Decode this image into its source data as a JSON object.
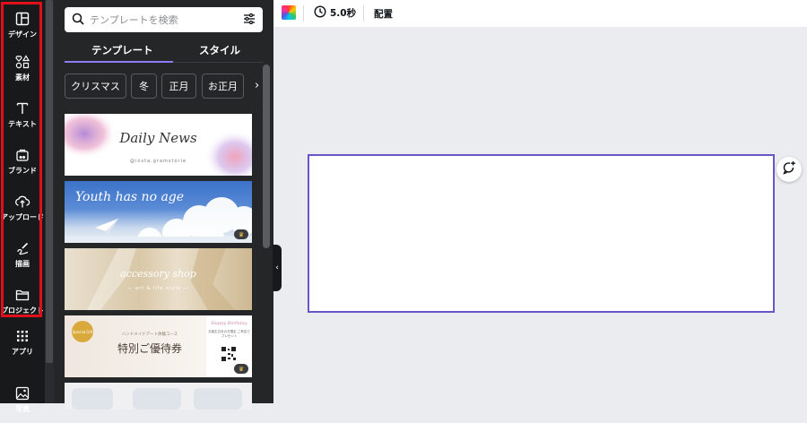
{
  "rail": {
    "items": [
      {
        "label": "デザイン",
        "icon": "layout-icon"
      },
      {
        "label": "素材",
        "icon": "shapes-icon"
      },
      {
        "label": "テキスト",
        "icon": "text-icon"
      },
      {
        "label": "ブランド",
        "icon": "brand-icon"
      },
      {
        "label": "アップロード",
        "icon": "upload-icon"
      },
      {
        "label": "描画",
        "icon": "draw-icon"
      },
      {
        "label": "プロジェクト",
        "icon": "folder-icon"
      },
      {
        "label": "アプリ",
        "icon": "apps-icon"
      },
      {
        "label": "写真",
        "icon": "photo-icon"
      }
    ]
  },
  "panel": {
    "search_placeholder": "テンプレートを検索",
    "tabs": [
      {
        "label": "テンプレート",
        "active": true
      },
      {
        "label": "スタイル",
        "active": false
      }
    ],
    "chips": [
      "クリスマス",
      "冬",
      "正月",
      "お正月"
    ],
    "templates": [
      {
        "title": "Daily News",
        "subtitle": "@insta.gramstorie"
      },
      {
        "title": "Youth has no age"
      },
      {
        "title": "accessory shop",
        "subtitle": "— art & life style —"
      },
      {
        "title": "特別ご優待券",
        "subtitle": "ハンドメイドアート体験コース",
        "badge": "Special Gift",
        "side_title": "Happy Birthday",
        "side_text": "お誕生日月の方限定 ご来店でプレゼント"
      }
    ]
  },
  "topbar": {
    "duration": "5.0秒",
    "arrange": "配置"
  },
  "colors": {
    "accent": "#8b7cf6",
    "highlight": "#e0101a",
    "canvas_border": "#6a55c8"
  }
}
